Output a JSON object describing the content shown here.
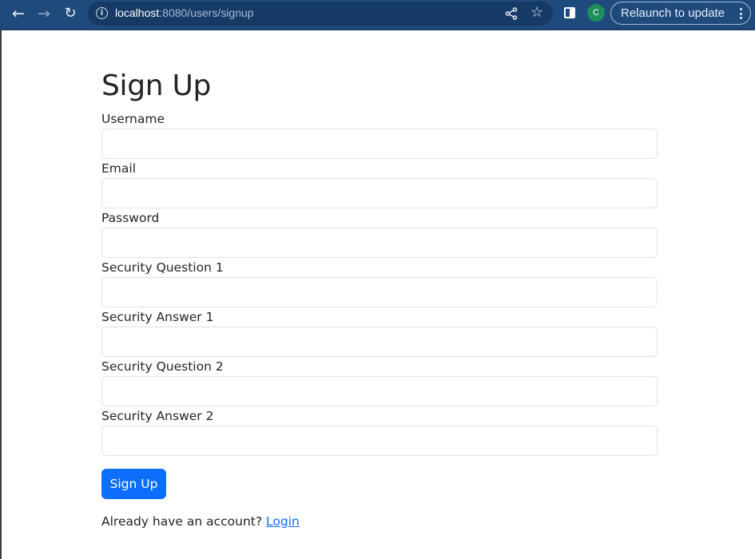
{
  "browser": {
    "url_host": "localhost",
    "url_rest": ":8080/users/signup",
    "profile_initial": "C",
    "relaunch_label": "Relaunch to update"
  },
  "form": {
    "title": "Sign Up",
    "fields": [
      {
        "label": "Username",
        "value": ""
      },
      {
        "label": "Email",
        "value": ""
      },
      {
        "label": "Password",
        "value": ""
      },
      {
        "label": "Security Question 1",
        "value": ""
      },
      {
        "label": "Security Answer 1",
        "value": ""
      },
      {
        "label": "Security Question 2",
        "value": ""
      },
      {
        "label": "Security Answer 2",
        "value": ""
      }
    ],
    "submit_label": "Sign Up",
    "footer_text": "Already have an account?",
    "login_link": "Login"
  },
  "colors": {
    "primary": "#0d6efd",
    "chrome": "#1f4a7c"
  }
}
